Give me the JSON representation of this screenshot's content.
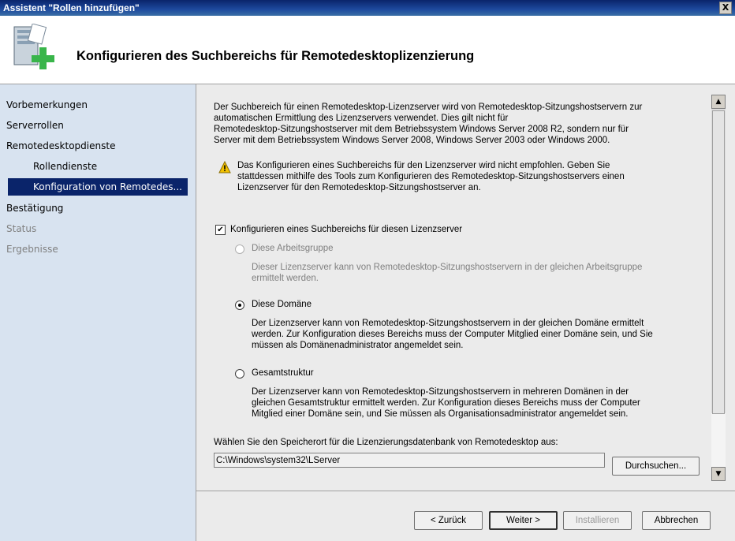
{
  "window": {
    "title": "Assistent \"Rollen hinzufügen\"",
    "close_label": "X"
  },
  "header": {
    "title": "Konfigurieren des Suchbereichs für Remotedesktoplizenzierung",
    "icon": "server-add-role-icon"
  },
  "nav": {
    "items": [
      {
        "label": "Vorbemerkungen",
        "state": "normal"
      },
      {
        "label": "Serverrollen",
        "state": "normal"
      },
      {
        "label": "Remotedesktopdienste",
        "state": "normal"
      },
      {
        "label": "Rollendienste",
        "state": "sub"
      },
      {
        "label": "Konfiguration von Remotedes...",
        "state": "selected"
      },
      {
        "label": "Bestätigung",
        "state": "normal"
      },
      {
        "label": "Status",
        "state": "disabled"
      },
      {
        "label": "Ergebnisse",
        "state": "disabled"
      }
    ]
  },
  "content": {
    "intro": [
      "Der Suchbereich für einen Remotedesktop-Lizenzserver wird von Remotedesktop-Sitzungshostservern zur",
      "automatischen Ermittlung des Lizenzservers verwendet. Dies gilt nicht für",
      "Remotedesktop-Sitzungshostserver mit dem Betriebssystem Windows Server 2008 R2, sondern nur für",
      "Server mit dem Betriebssystem Windows Server 2008, Windows Server 2003 oder Windows 2000."
    ],
    "warning": [
      "Das Konfigurieren eines Suchbereichs für den Lizenzserver wird nicht empfohlen. Geben Sie",
      "stattdessen mithilfe des Tools zum Konfigurieren des Remotedesktop-Sitzungshostservers einen",
      "Lizenzserver für den Remotedesktop-Sitzungshostserver an."
    ],
    "checkbox_label": "Konfigurieren eines Suchbereichs für diesen Lizenzserver",
    "checkbox_checked": true,
    "options": [
      {
        "label": "Diese Arbeitsgruppe",
        "selected": false,
        "enabled": false,
        "desc": [
          "Dieser Lizenzserver kann von Remotedesktop-Sitzungshostservern in der gleichen Arbeitsgruppe",
          "ermittelt werden."
        ]
      },
      {
        "label": "Diese Domäne",
        "selected": true,
        "enabled": true,
        "desc": [
          "Der Lizenzserver kann von Remotedesktop-Sitzungshostservern in der gleichen Domäne ermittelt",
          "werden. Zur Konfiguration dieses Bereichs muss der Computer Mitglied einer Domäne sein, und Sie",
          "müssen als Domänenadministrator angemeldet sein."
        ]
      },
      {
        "label": "Gesamtstruktur",
        "selected": false,
        "enabled": true,
        "desc": [
          "Der Lizenzserver kann von Remotedesktop-Sitzungshostservern in mehreren Domänen in der",
          "gleichen Gesamtstruktur ermittelt werden. Zur Konfiguration dieses Bereichs muss der Computer",
          "Mitglied einer Domäne sein, und Sie müssen als Organisationsadministrator angemeldet sein."
        ]
      }
    ],
    "db_label": "Wählen Sie den Speicherort für die Lizenzierungsdatenbank von Remotedesktop aus:",
    "db_path": "C:\\Windows\\system32\\LServer",
    "browse_label": "Durchsuchen..."
  },
  "buttons": {
    "back": "< Zurück",
    "next": "Weiter >",
    "install": "Installieren",
    "cancel": "Abbrechen"
  }
}
